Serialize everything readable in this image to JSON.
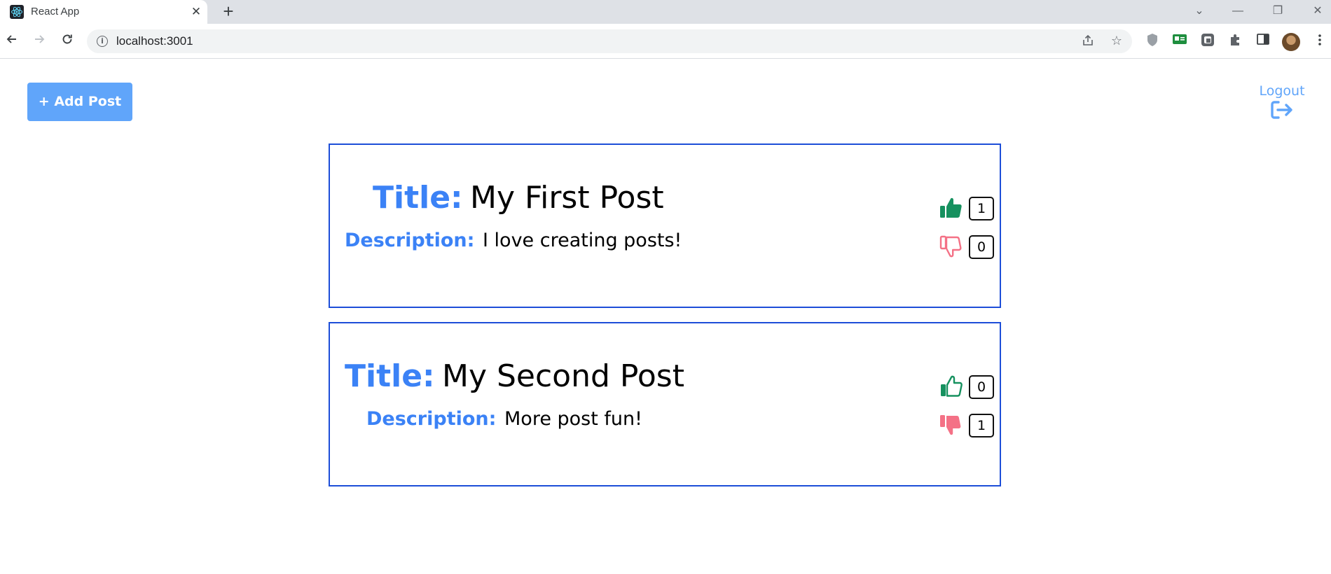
{
  "browser": {
    "tab_title": "React App",
    "tab_close_glyph": "✕",
    "new_tab_glyph": "+",
    "url": "localhost:3001",
    "window_controls": [
      "⌄",
      "—",
      "❐",
      "✕"
    ]
  },
  "header": {
    "add_post_label": "+ Add Post",
    "logout_label": "Logout"
  },
  "labels": {
    "title": "Title:",
    "description": "Description:"
  },
  "colors": {
    "accent_blue": "#3b82f6",
    "button_blue": "#60a5fa",
    "card_border": "#1d4ed8",
    "like_green": "#16915f",
    "dislike_pink": "#f47186"
  },
  "posts": [
    {
      "title": "My First Post",
      "description": "I love creating posts!",
      "likes": "1",
      "dislikes": "0",
      "liked": true,
      "disliked": false
    },
    {
      "title": "My Second Post",
      "description": "More post fun!",
      "likes": "0",
      "dislikes": "1",
      "liked": false,
      "disliked": true
    }
  ]
}
